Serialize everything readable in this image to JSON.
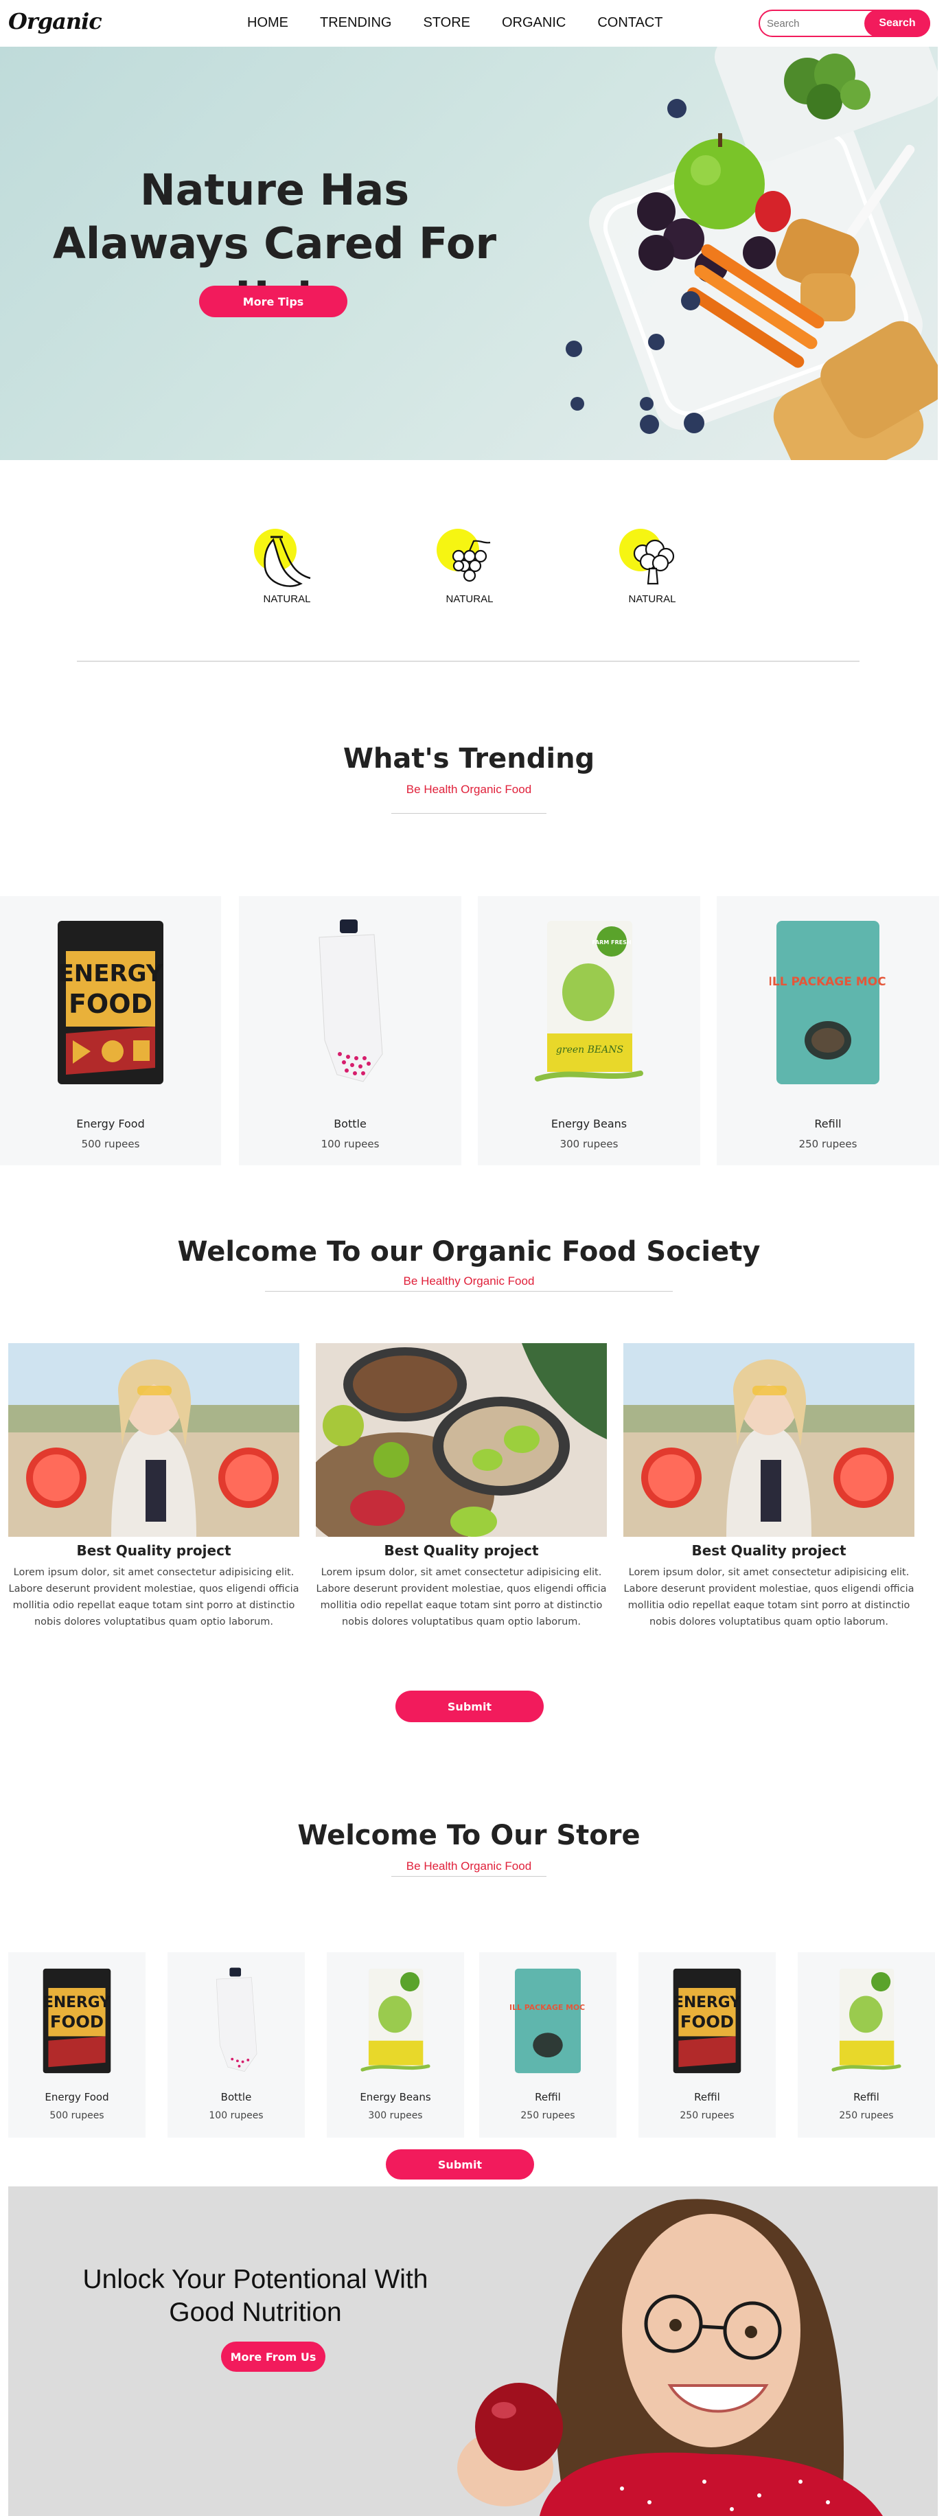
{
  "nav": {
    "brand": "Organic",
    "menu": [
      "HOME",
      "TRENDING",
      "STORE",
      "ORGANIC",
      "CONTACT"
    ],
    "search_placeholder": "Search",
    "search_button": "Search"
  },
  "hero": {
    "title": "Nature Has Alaways Cared For Us!",
    "button": "More Tips"
  },
  "features": [
    {
      "icon": "banana-icon",
      "label": "NATURAL"
    },
    {
      "icon": "grapes-icon",
      "label": "NATURAL"
    },
    {
      "icon": "broccoli-icon",
      "label": "NATURAL"
    }
  ],
  "trending": {
    "title": "What's Trending",
    "subtitle": "Be Health Organic Food",
    "products": [
      {
        "name": "Energy Food",
        "price": "500 rupees"
      },
      {
        "name": "Bottle",
        "price": "100 rupees"
      },
      {
        "name": "Energy Beans",
        "price": "300 rupees"
      },
      {
        "name": "Refill",
        "price": "250 rupees"
      }
    ]
  },
  "society": {
    "title": "Welcome To our Organic Food Society",
    "subtitle": "Be Healthy Organic Food",
    "projects": [
      {
        "title": "Best Quality project",
        "text": "Lorem ipsum dolor, sit amet consectetur adipisicing elit. Labore deserunt provident molestiae, quos eligendi officia mollitia odio repellat eaque totam sint porro at distinctio nobis dolores voluptatibus quam optio laborum."
      },
      {
        "title": "Best Quality project",
        "text": "Lorem ipsum dolor, sit amet consectetur adipisicing elit. Labore deserunt provident molestiae, quos eligendi officia mollitia odio repellat eaque totam sint porro at distinctio nobis dolores voluptatibus quam optio laborum."
      },
      {
        "title": "Best Quality project",
        "text": "Lorem ipsum dolor, sit amet consectetur adipisicing elit. Labore deserunt provident molestiae, quos eligendi officia mollitia odio repellat eaque totam sint porro at distinctio nobis dolores voluptatibus quam optio laborum."
      }
    ],
    "button": "Submit"
  },
  "store": {
    "title": "Welcome To Our Store",
    "subtitle": "Be Health Organic Food",
    "products": [
      {
        "name": "Energy Food",
        "price": "500 rupees"
      },
      {
        "name": "Bottle",
        "price": "100 rupees"
      },
      {
        "name": "Energy Beans",
        "price": "300 rupees"
      },
      {
        "name": "Reffil",
        "price": "250 rupees"
      },
      {
        "name": "Reffil",
        "price": "250 rupees"
      },
      {
        "name": "Reffil",
        "price": "250 rupees"
      }
    ],
    "button": "Submit"
  },
  "banner": {
    "title": "Unlock Your Potentional With Good Nutrition",
    "button": "More From Us"
  },
  "packs": {
    "energy_line1": "ENERGY",
    "energy_line2": "FOOD",
    "beans_badge": "FARM FRESH",
    "beans_label": "green BEANS",
    "refill_text": "REFILL PACKAGE MOCKUP"
  },
  "colors": {
    "accent": "#f21b5c",
    "subtitle_red": "#e0203a",
    "feature_dot": "#f6f512",
    "hero_bg": "#c9e0de",
    "card_bg": "#f6f7f8",
    "banner_bg": "#dcdcdc"
  }
}
